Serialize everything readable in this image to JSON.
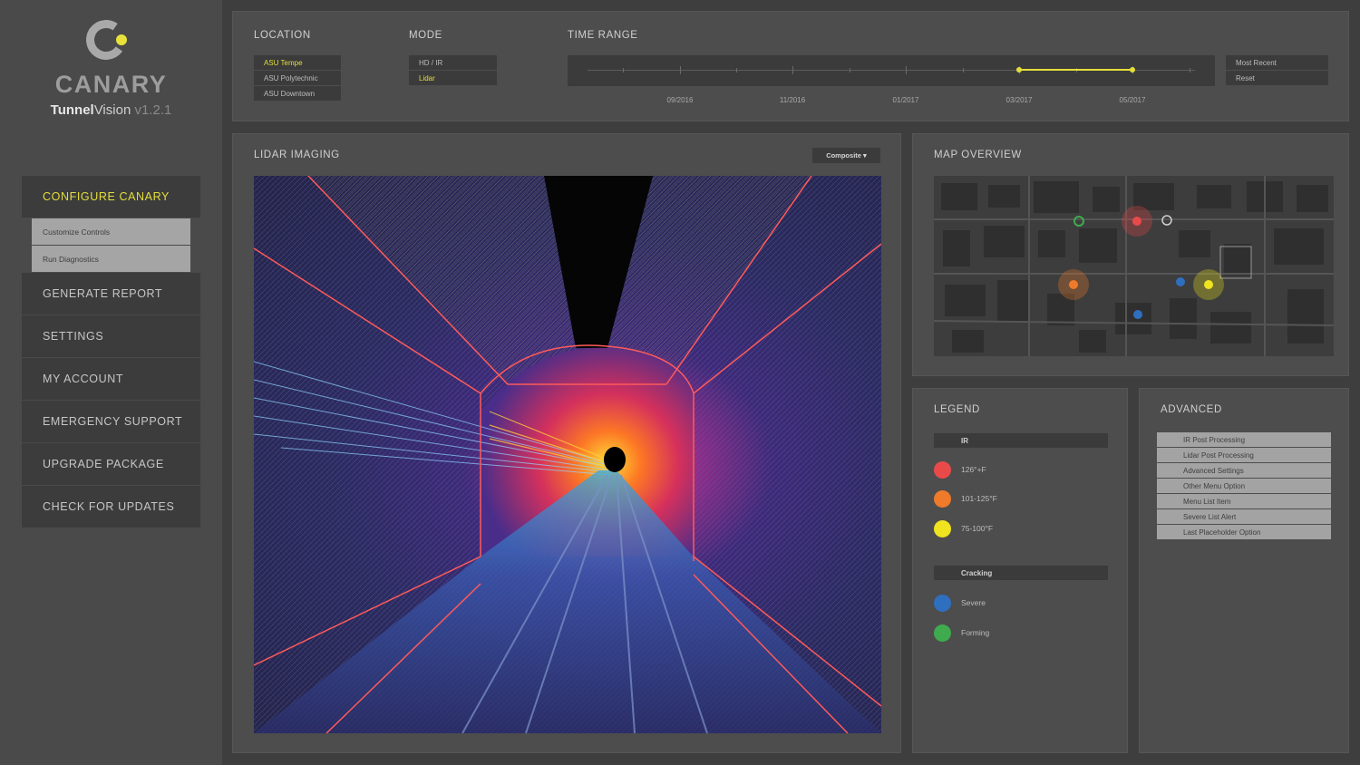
{
  "app": {
    "brand": "CANARY",
    "product_bold": "Tunnel",
    "product_light": "Vision",
    "version": " v1.2.1"
  },
  "nav": {
    "configure": "CONFIGURE CANARY",
    "sub": [
      "Customize Controls",
      "Run Diagnostics"
    ],
    "items": [
      "GENERATE REPORT",
      "SETTINGS",
      "MY ACCOUNT",
      "EMERGENCY SUPPORT",
      "UPGRADE PACKAGE",
      "CHECK FOR UPDATES"
    ]
  },
  "filters": {
    "location_title": "LOCATION",
    "locations": [
      "ASU Tempe",
      "ASU Polytechnic",
      "ASU Downtown"
    ],
    "location_selected": 0,
    "mode_title": "MODE",
    "modes": [
      "HD / IR",
      "Lidar"
    ],
    "mode_selected": 1,
    "time_title": "TIME RANGE",
    "time_labels": [
      "09/2016",
      "11/2016",
      "01/2017",
      "03/2017",
      "05/2017"
    ],
    "range_start": "03/2017",
    "range_end": "05/2017",
    "time_actions": [
      "Most Recent",
      "Reset"
    ]
  },
  "lidar": {
    "title": "LIDAR IMAGING",
    "view_select": "Composite ▾"
  },
  "map": {
    "title": "MAP OVERVIEW"
  },
  "legend": {
    "title": "LEGEND",
    "ir_header": "IR",
    "ir": [
      {
        "label": "126°+F",
        "color": "#e84a4a"
      },
      {
        "label": "101-125°F",
        "color": "#ee7a2a"
      },
      {
        "label": "75-100°F",
        "color": "#f0e31f"
      }
    ],
    "crack_header": "Cracking",
    "cracking": [
      {
        "label": "Severe",
        "color": "#2f6fc0"
      },
      {
        "label": "Forming",
        "color": "#3fab4e"
      }
    ]
  },
  "advanced": {
    "title": "ADVANCED",
    "items": [
      "IR Post Processing",
      "Lidar Post Processing",
      "Advanced Settings",
      "Other Menu Option",
      "Menu List Item",
      "Severe List Alert",
      "Last Placeholder Option"
    ]
  }
}
